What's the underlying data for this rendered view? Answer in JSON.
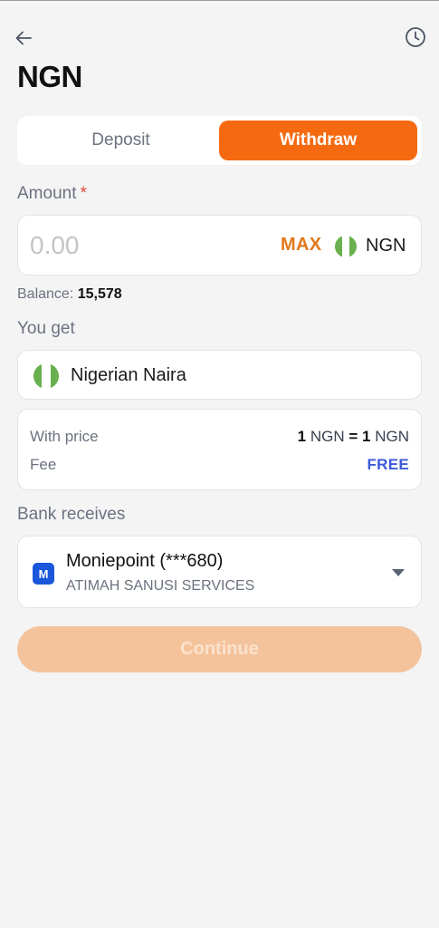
{
  "header": {
    "title": "NGN",
    "back_icon": "arrow-left-icon",
    "history_icon": "clock-icon"
  },
  "tabs": [
    {
      "label": "Deposit",
      "selected": false
    },
    {
      "label": "Withdraw",
      "selected": true
    }
  ],
  "amount": {
    "label": "Amount",
    "required_mark": "*",
    "placeholder": "0.00",
    "value": "",
    "max_label": "MAX",
    "currency": "NGN"
  },
  "balance": {
    "label": "Balance:",
    "value": "15,578"
  },
  "you_get": {
    "label": "You get",
    "currency_name": "Nigerian Naira"
  },
  "pricing": {
    "with_price_label": "With price",
    "rate_left_amount": "1",
    "rate_left_unit": "NGN",
    "rate_equals": "=",
    "rate_right_amount": "1",
    "rate_right_unit": "NGN",
    "fee_label": "Fee",
    "fee_value": "FREE"
  },
  "bank": {
    "label": "Bank receives",
    "logo_letter": "M",
    "name": "Moniepoint (***680)",
    "holder": "ATIMAH SANUSI SERVICES"
  },
  "continue_label": "Continue",
  "colors": {
    "accent": "#f56a11",
    "accent_disabled": "#f4c39c",
    "max_text": "#e2791b",
    "fee_free": "#3b5bdb",
    "flag_green": "#6ab04c",
    "bank_logo": "#1a56db"
  }
}
